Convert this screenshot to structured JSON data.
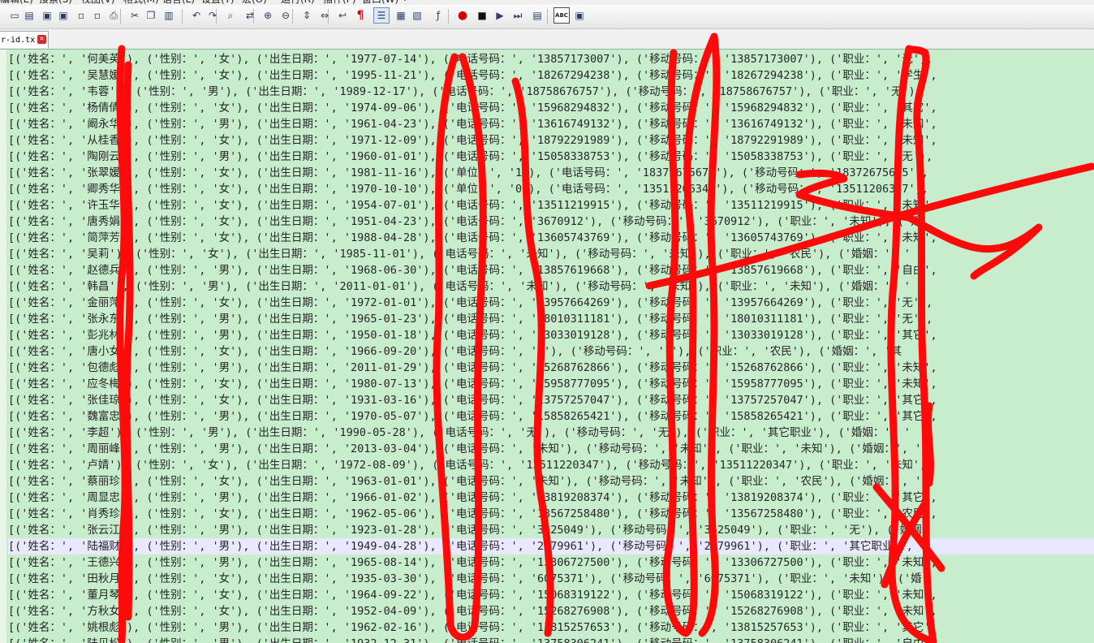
{
  "menu": [
    "编辑(E)",
    "搜索(S)",
    "视图(V)",
    "格式(M)",
    "语言(L)",
    "设置(T)",
    "宏(O)",
    "运行(R)",
    "插件(P)",
    "窗口(W)",
    "?"
  ],
  "toolbar_icons": [
    "new-file-icon",
    "open-file-icon",
    "save-icon",
    "save-all-icon",
    "close-icon",
    "close-all-icon",
    "print-icon",
    "cut-icon",
    "copy-icon",
    "paste-icon",
    "undo-icon",
    "redo-icon",
    "find-icon",
    "replace-icon",
    "zoom-in-icon",
    "zoom-out-icon",
    "sync-vertical-icon",
    "sync-horizontal-icon",
    "word-wrap-icon",
    "show-all-chars-icon",
    "indent-guide-icon",
    "user-language-icon",
    "document-map-icon",
    "function-list-icon",
    "record-macro-icon",
    "stop-record-icon",
    "play-macro-icon",
    "run-multiple-macro-icon",
    "save-macro-icon",
    "spell-check-icon",
    "spell-options-icon"
  ],
  "tab": {
    "label": "r-id.tx",
    "close_glyph": "✕"
  },
  "lines": [
    "[('姓名：', '何美英'), ('性别：', '女'), ('出生日期：', '1977-07-14'), ('电话号码：', '13857173007'), ('移动号码：', '13857173007'), ('职业：', '无'),",
    "[('姓名：', '吴慧媛'), ('性别：', '女'), ('出生日期：', '1995-11-21'), ('电话号码：', '18267294238'), ('移动号码：', '18267294238'), ('职业：', '学生',",
    "[('姓名：', '韦蓉'), ('性别：', '男'), ('出生日期：', '1989-12-17'), ('电话号码：', '18758676757'), ('移动号码：', '18758676757'), ('职业：', '无'),",
    "[('姓名：', '杨倩倩'), ('性别：', '女'), ('出生日期：', '1974-09-06'), ('电话号码：', '15968294832'), ('移动号码：', '15968294832'), ('职业：', '其它',",
    "[('姓名：', '阚永华'), ('性别：', '男'), ('出生日期：', '1961-04-23'), ('电话号码：', '13616749132'), ('移动号码：', '13616749132'), ('职业：', '未知',",
    "[('姓名：', '从桂香'), ('性别：', '女'), ('出生日期：', '1971-12-09'), ('电话号码：', '18792291989'), ('移动号码：', '18792291989'), ('职业：', '未知',",
    "[('姓名：', '陶刚云'), ('性别：', '男'), ('出生日期：', '1960-01-01'), ('电话号码：', '15058338753'), ('移动号码：', '15058338753'), ('职业：', '无'),",
    "[('姓名：', '张翠媛'), ('性别：', '女'), ('出生日期：', '1981-11-16'), ('单位：', '1'), ('电话号码：', '18372675675'), ('移动号码：', '18372675675'),",
    "[('姓名：', '卿秀华'), ('性别：', '女'), ('出生日期：', '1970-10-10'), ('单位：', '0'), ('电话号码：', '13511206347'), ('移动号码：', '13511206347'),",
    "[('姓名：', '许玉华'), ('性别：', '女'), ('出生日期：', '1954-07-01'), ('电话号码：', '13511219915'), ('移动号码：', '13511219915'), ('职业：', '未知',",
    "[('姓名：', '唐秀娟'), ('性别：', '女'), ('出生日期：', '1951-04-23'), ('电话号码：', '3670912'), ('移动号码：', '3670912'), ('职业：', '未知'), ('婚",
    "[('姓名：', '简萍芳'), ('性别：', '女'), ('出生日期：', '1988-04-28'), ('电话号码：', '13605743769'), ('移动号码：', '13605743769'), ('职业：', '未知',",
    "[('姓名：', '吴莉'), ('性别：', '女'), ('出生日期：', '1985-11-01'), ('电话号码：', '未知'), ('移动号码：', '未知'), ('职业：', '农民'), ('婚姻：', '",
    "[('姓名：', '赵德兵'), ('性别：', '男'), ('出生日期：', '1968-06-30'), ('电话号码：', '13857619668'), ('移动号码：', '13857619668'), ('职业：', '自由',",
    "[('姓名：', '韩昌'), ('性别：', '男'), ('出生日期：', '2011-01-01'), ('电话号码：', '未知'), ('移动号码：', '未知'), ('职业：', '未知'), ('婚姻：', '",
    "[('姓名：', '金丽萍'), ('性别：', '女'), ('出生日期：', '1972-01-01'), ('电话号码：', '13957664269'), ('移动号码：', '13957664269'), ('职业：', '无'),",
    "[('姓名：', '张永东'), ('性别：', '男'), ('出生日期：', '1965-01-23'), ('电话号码：', '18010311181'), ('移动号码：', '18010311181'), ('职业：', '无'),",
    "[('姓名：', '彭兆林'), ('性别：', '男'), ('出生日期：', '1950-01-18'), ('电话号码：', '13033019128'), ('移动号码：', '13033019128'), ('职业：', '其它',",
    "[('姓名：', '唐小女'), ('性别：', '女'), ('出生日期：', '1966-09-20'), ('电话号码：', '?'), ('移动号码：', '?'), ('职业：', '农民'), ('婚姻：', '其",
    "[('姓名：', '包德彪'), ('性别：', '男'), ('出生日期：', '2011-01-29'), ('电话号码：', '15268762866'), ('移动号码：', '15268762866'), ('职业：', '未知',",
    "[('姓名：', '应冬梅'), ('性别：', '女'), ('出生日期：', '1980-07-13'), ('电话号码：', '15958777095'), ('移动号码：', '15958777095'), ('职业：', '未知',",
    "[('姓名：', '张佳琼'), ('性别：', '女'), ('出生日期：', '1931-03-16'), ('电话号码：', '13757257047'), ('移动号码：', '13757257047'), ('职业：', '其它',",
    "[('姓名：', '魏富忠'), ('性别：', '男'), ('出生日期：', '1970-05-07'), ('电话号码：', '15858265421'), ('移动号码：', '15858265421'), ('职业：', '其它',",
    "[('姓名：', '李超'), ('性别：', '男'), ('出生日期：', '1990-05-28'), ('电话号码：', '无'), ('移动号码：', '无'), ('职业：', '其它职业'), ('婚姻：', '",
    "[('姓名：', '周丽峰'), ('性别：', '男'), ('出生日期：', '2013-03-04'), ('电话号码：', '未知'), ('移动号码：', '未知'), ('职业：', '未知'), ('婚姻：', '",
    "[('姓名：', '卢婧'), ('性别：', '女'), ('出生日期：', '1972-08-09'), ('电话号码：', '13511220347'), ('移动号码：', '13511220347'), ('职业：', '未知',",
    "[('姓名：', '蔡丽珍'), ('性别：', '女'), ('出生日期：', '1963-01-01'), ('电话号码：', '未知'), ('移动号码：', '未知'), ('职业：', '农民'), ('婚姻：', '",
    "[('姓名：', '周显忠'), ('性别：', '男'), ('出生日期：', '1966-01-02'), ('电话号码：', '13819208374'), ('移动号码：', '13819208374'), ('职业：', '其它',",
    "[('姓名：', '肖秀珍'), ('性别：', '女'), ('出生日期：', '1962-05-06'), ('电话号码：', '13567258480'), ('移动号码：', '13567258480'), ('职业：', '农民',",
    "[('姓名：', '张云江'), ('性别：', '男'), ('出生日期：', '1923-01-28'), ('电话号码：', '3625049'), ('移动号码：', '3625049'), ('职业：', '无'), ('婚姻",
    "[('姓名：', '陆福财'), ('性别：', '男'), ('出生日期：', '1949-04-28'), ('电话号码：', '2979961'), ('移动号码：', '2979961'), ('职业：', '其它职业'), (",
    "[('姓名：', '王德兴'), ('性别：', '男'), ('出生日期：', '1965-08-14'), ('电话号码：', '13306727500'), ('移动号码：', '13306727500'), ('职业：', '未知',",
    "[('姓名：', '田秋月'), ('性别：', '女'), ('出生日期：', '1935-03-30'), ('电话号码：', '6075371'), ('移动号码：', '6075371'), ('职业：', '未知'), ('婚",
    "[('姓名：', '董月琴'), ('性别：', '女'), ('出生日期：', '1964-09-22'), ('电话号码：', '15068319122'), ('移动号码：', '15068319122'), ('职业：', '未知',",
    "[('姓名：', '方秋女'), ('性别：', '女'), ('出生日期：', '1952-04-09'), ('电话号码：', '15268276908'), ('移动号码：', '15268276908'), ('职业：', '未知',",
    "[('姓名：', '姚根彪'), ('性别：', '男'), ('出生日期：', '1962-02-16'), ('电话号码：', '13815257653'), ('移动号码：', '13815257653'), ('职业：', '其它',",
    "[('姓名：', '陆贝松'), ('性别：', '男'), ('出生日期：', '1932-12-31'), ('电话号码：', '13758306241'), ('移动号码：', '13758306241'), ('职业：', '自由',"
  ],
  "current_line_index": 30
}
